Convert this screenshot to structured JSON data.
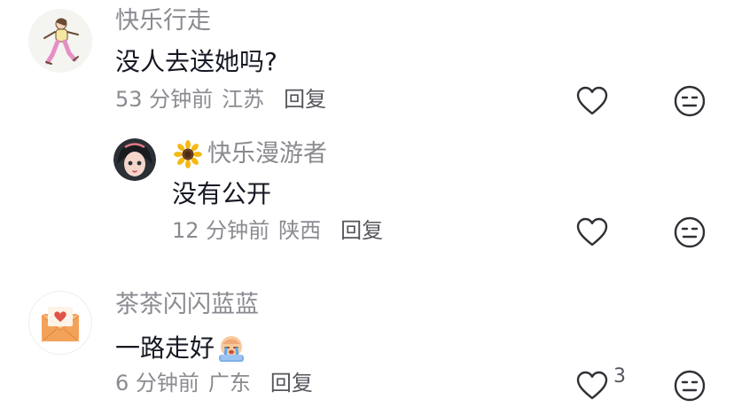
{
  "comments": [
    {
      "username": "快乐行走",
      "content": "没人去送她吗?",
      "time": "53 分钟前",
      "location": "江苏",
      "reply_label": "回复",
      "like_count": ""
    },
    {
      "badge_icon": "sunflower-icon",
      "username": "快乐漫游者",
      "content": "没有公开",
      "time": "12 分钟前",
      "location": "陕西",
      "reply_label": "回复",
      "like_count": ""
    },
    {
      "username": "茶茶闪闪蓝蓝",
      "content": "一路走好",
      "content_emoji": "crying-emoji",
      "time": "6 分钟前",
      "location": "广东",
      "reply_label": "回复",
      "like_count": "3"
    }
  ],
  "colors": {
    "primary_text": "#161823",
    "secondary_text": "#8a8b91",
    "reply_text": "#55565c",
    "icon_stroke": "#2f3036"
  }
}
